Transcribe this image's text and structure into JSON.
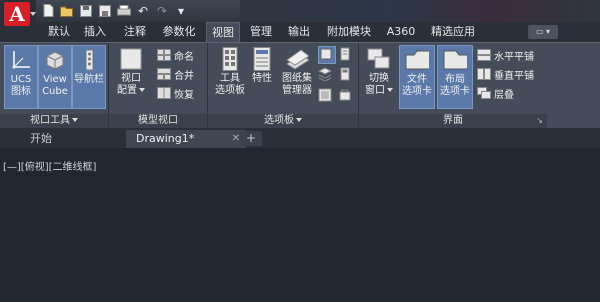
{
  "quick_access": {
    "icons": [
      "new-icon",
      "open-icon",
      "save-icon",
      "save-as-icon",
      "print-icon",
      "undo-icon",
      "redo-icon",
      "customize-icon"
    ]
  },
  "app_logo": "A",
  "tabs": [
    {
      "label": "默认"
    },
    {
      "label": "插入"
    },
    {
      "label": "注释"
    },
    {
      "label": "参数化"
    },
    {
      "label": "视图"
    },
    {
      "label": "管理"
    },
    {
      "label": "输出"
    },
    {
      "label": "附加模块"
    },
    {
      "label": "A360"
    },
    {
      "label": "精选应用"
    }
  ],
  "active_tab": "视图",
  "panels": {
    "viewport_tools": {
      "title": "视口工具",
      "buttons": [
        {
          "line1": "UCS",
          "line2": "图标"
        },
        {
          "line1": "View",
          "line2": "Cube"
        },
        {
          "line1": "导航栏",
          "line2": ""
        }
      ]
    },
    "model_viewports": {
      "title": "模型视口",
      "big_button": {
        "line1": "视口",
        "line2": "配置"
      },
      "small_buttons": [
        "命名",
        "合并",
        "恢复"
      ]
    },
    "palettes": {
      "title": "选项板",
      "buttons": [
        {
          "line1": "工具",
          "line2": "选项板"
        },
        {
          "line1": "特性",
          "line2": ""
        },
        {
          "line1": "图纸集",
          "line2": "管理器"
        }
      ]
    },
    "interface": {
      "title": "界面",
      "buttons": [
        {
          "line1": "切换",
          "line2": "窗口"
        },
        {
          "line1": "文件",
          "line2": "选项卡"
        },
        {
          "line1": "布局",
          "line2": "选项卡"
        }
      ],
      "small_buttons": [
        "水平平铺",
        "垂直平铺",
        "层叠"
      ]
    }
  },
  "doc_tabs": [
    {
      "label": "开始"
    },
    {
      "label": "Drawing1*"
    }
  ],
  "viewport_label": "[—][俯视][二维线框]",
  "colors": {
    "accent_pressed": "#5a78a8",
    "logo_red": "#d81f27",
    "canvas": "#212631"
  }
}
